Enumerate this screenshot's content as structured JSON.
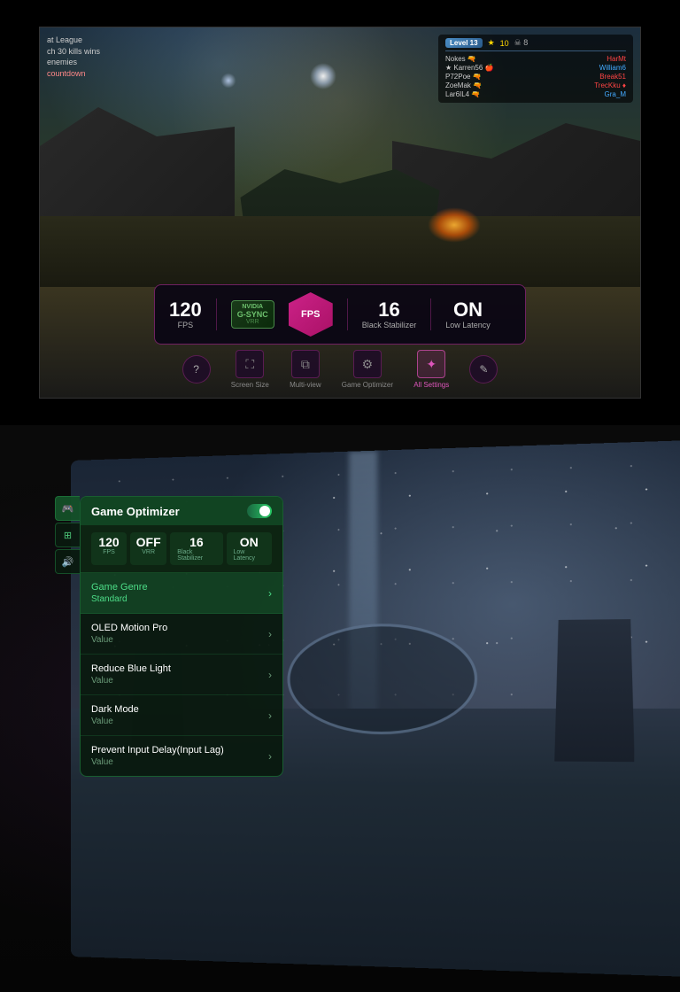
{
  "topSection": {
    "hud": {
      "topLeft": {
        "line1": "at League",
        "line2": "ch 30 kills wins",
        "line3": "enemies",
        "line4": "countdown"
      },
      "topRight": {
        "levelBadge": "Level 13",
        "starValue": "10",
        "players": [
          {
            "name": "Nokes",
            "opponent": "HarMt",
            "opponentColor": "red"
          },
          {
            "name": "Karren56",
            "opponent": "William6",
            "opponentColor": "blue"
          },
          {
            "name": "P72Poe",
            "opponent": "Break51",
            "opponentColor": "red"
          },
          {
            "name": "ZoeMak",
            "opponent": "TrecKku",
            "opponentColor": "red"
          },
          {
            "name": "Lar6IL4",
            "opponent": "Gra_M",
            "opponentColor": "blue"
          }
        ]
      }
    },
    "statsBar": {
      "fps": "120",
      "fpsLabel": "FPS",
      "gsyncLine1": "NVIDIA",
      "gsyncLine2": "G-SYNC",
      "gsyncLine3": "VRR",
      "centerLabel": "FPS",
      "blackStabilizer": "16",
      "blackStabilizerLabel": "Black Stabilizer",
      "lowLatency": "ON",
      "lowLatencyLabel": "Low Latency"
    },
    "bottomNav": {
      "helpLabel": "",
      "screenSizeLabel": "Screen Size",
      "multiViewLabel": "Multi-view",
      "gameOptimizerLabel": "Game Optimizer",
      "allSettingsLabel": "All Settings",
      "editLabel": ""
    }
  },
  "bottomSection": {
    "panel": {
      "title": "Game Optimizer",
      "toggleOn": true,
      "stats": [
        {
          "value": "120",
          "label": "FPS"
        },
        {
          "value": "OFF",
          "label": "VRR"
        },
        {
          "value": "16",
          "label": "Black Stabilizer"
        },
        {
          "value": "ON",
          "label": "Low Latency"
        }
      ],
      "menuItems": [
        {
          "name": "Game Genre",
          "value": "Standard",
          "active": true
        },
        {
          "name": "OLED Motion Pro",
          "value": "Value",
          "active": false
        },
        {
          "name": "Reduce Blue Light",
          "value": "Value",
          "active": false
        },
        {
          "name": "Dark Mode",
          "value": "Value",
          "active": false
        },
        {
          "name": "Prevent Input Delay(Input Lag)",
          "value": "Value",
          "active": false
        }
      ],
      "sideIcons": [
        {
          "icon": "🎮",
          "active": true
        },
        {
          "icon": "⊞",
          "active": false
        },
        {
          "icon": "🔊",
          "active": false
        }
      ]
    }
  }
}
